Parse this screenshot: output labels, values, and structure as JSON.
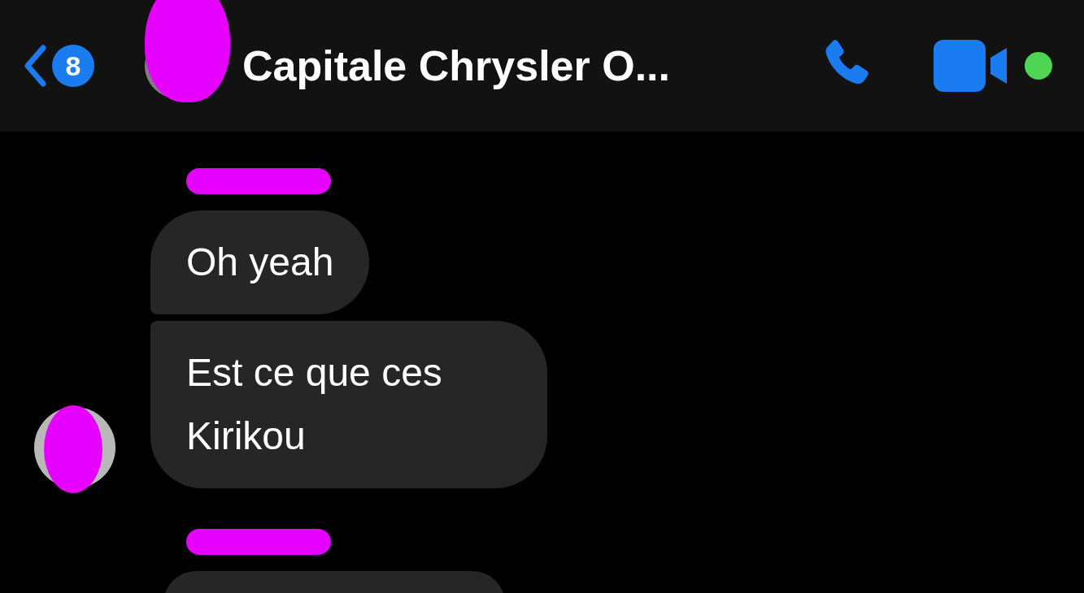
{
  "header": {
    "back_badge": "8",
    "title": "Capitale Chrysler O...",
    "online": true
  },
  "groups": [
    {
      "has_avatar": true,
      "messages": [
        {
          "kind": "text",
          "text": "Oh yeah"
        },
        {
          "kind": "text",
          "text": "Est ce que ces Kirikou"
        }
      ]
    },
    {
      "has_avatar": false,
      "messages": [
        {
          "kind": "cut"
        }
      ]
    }
  ]
}
